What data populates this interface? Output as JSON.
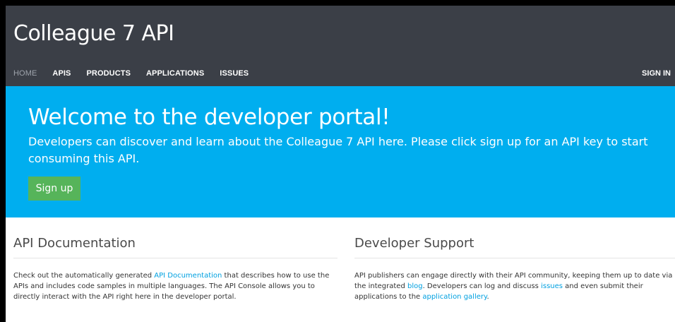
{
  "header": {
    "title": "Colleague 7 API",
    "nav": [
      "HOME",
      "APIS",
      "PRODUCTS",
      "APPLICATIONS",
      "ISSUES"
    ],
    "active_nav": "HOME",
    "sign_in": "SIGN IN"
  },
  "hero": {
    "title": "Welcome to the developer portal!",
    "text": "Developers can discover and learn about the Colleague 7 API here. Please click sign up for an API key to start consuming this API.",
    "signup_label": "Sign up"
  },
  "docs": {
    "heading": "API Documentation",
    "text_1": "Check out the automatically generated ",
    "link": "API Documentation",
    "text_2": " that describes how to use the APIs and includes code samples in multiple languages. The API Console allows you to directly interact with the API right here in the developer portal."
  },
  "support": {
    "heading": "Developer Support",
    "text_1": "API publishers can engage directly with their API community, keeping them up to date via the integrated ",
    "link_blog": "blog",
    "text_2": ". Developers can log and discuss ",
    "link_issues": "issues",
    "text_3": " and even submit their applications to the ",
    "link_gallery": "application gallery",
    "text_4": "."
  },
  "colors": {
    "header_bg": "#3b3f47",
    "hero_bg": "#00aeef",
    "signup_bg": "#56b45a",
    "link": "#00a0e0"
  }
}
